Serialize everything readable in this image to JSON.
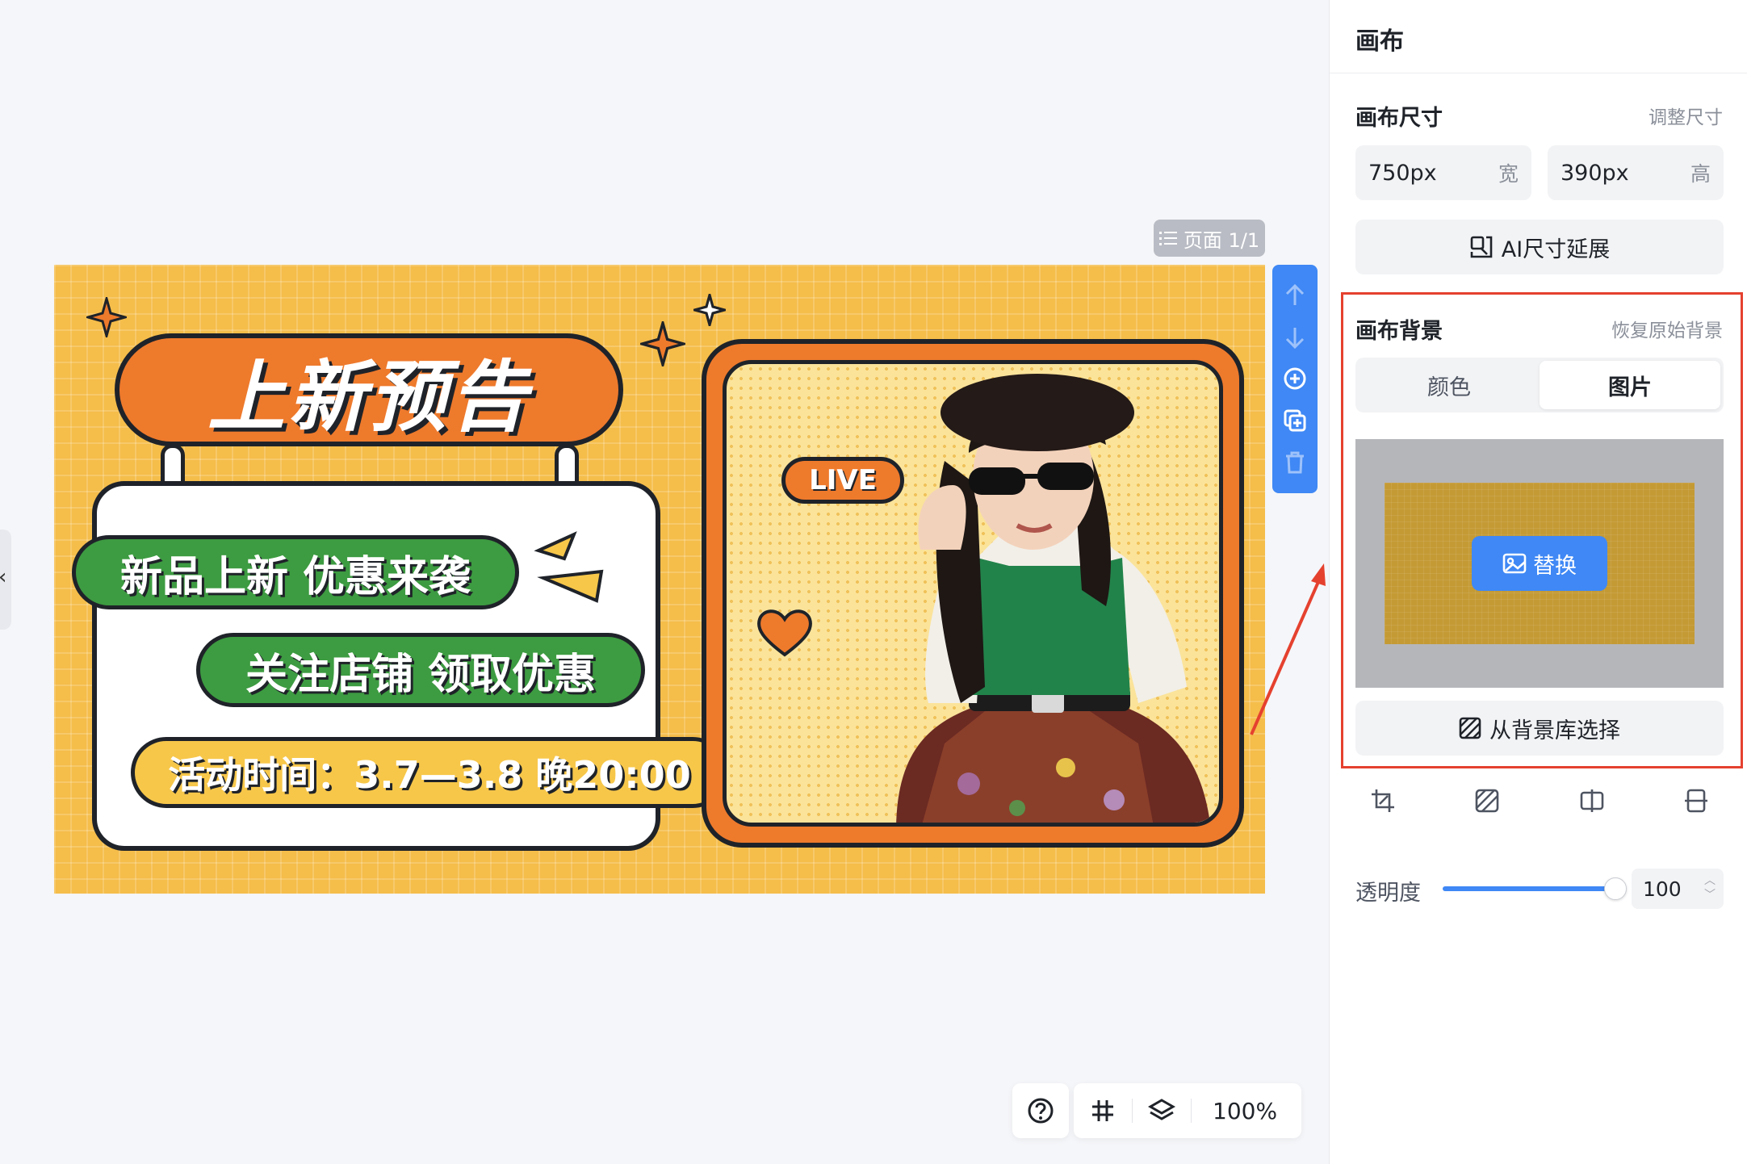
{
  "canvas": {
    "page_indicator": "页面 1/1",
    "zoom": "100%",
    "banner": {
      "title": "上新预告",
      "line1": "新品上新 优惠来袭",
      "line2": "关注店铺 领取优惠",
      "line3": "活动时间：3.7—3.8 晚20:00",
      "live": "LIVE"
    }
  },
  "panel": {
    "title": "画布",
    "size_section": {
      "title": "画布尺寸",
      "link": "调整尺寸",
      "width": {
        "value": "750px",
        "unit": "宽"
      },
      "height": {
        "value": "390px",
        "unit": "高"
      },
      "ai_button": "AI尺寸延展"
    },
    "bg_section": {
      "title": "画布背景",
      "link": "恢复原始背景",
      "tabs": [
        {
          "label": "颜色",
          "active": false
        },
        {
          "label": "图片",
          "active": true
        }
      ],
      "replace_button": "替换",
      "library_button": "从背景库选择"
    },
    "opacity": {
      "label": "透明度",
      "value": "100"
    }
  },
  "colors": {
    "accent": "#3f88f5",
    "banner_bg": "#f5bd4a",
    "highlight": "#e5412f",
    "orange": "#ee7a2c",
    "green": "#3d9b41"
  },
  "icons": [
    "list-icon",
    "arrow-up-icon",
    "arrow-down-icon",
    "plus-circle-icon",
    "duplicate-icon",
    "trash-icon",
    "help-icon",
    "grid-icon",
    "layers-icon",
    "ai-resize-icon",
    "image-icon",
    "pattern-icon",
    "crop-icon",
    "flip-horizontal-icon",
    "flip-vertical-icon"
  ]
}
